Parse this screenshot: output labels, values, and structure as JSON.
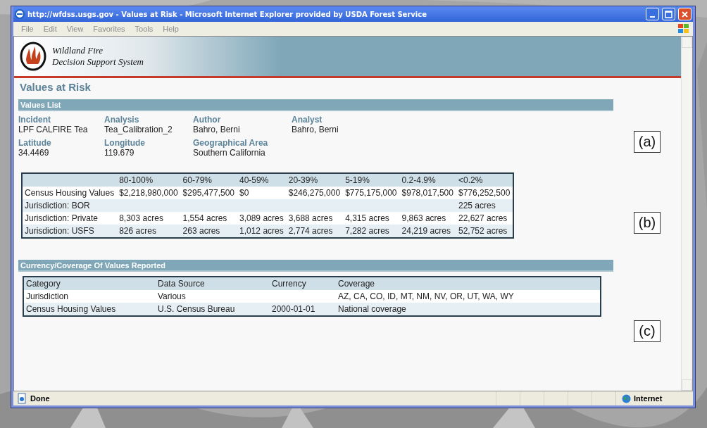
{
  "window": {
    "title": "http://wfdss.usgs.gov - Values at Risk - Microsoft Internet Explorer provided by USDA Forest Service"
  },
  "menu": [
    "File",
    "Edit",
    "View",
    "Favorites",
    "Tools",
    "Help"
  ],
  "header": {
    "logo_lines": [
      "Wildland Fire",
      "Decision Support System"
    ]
  },
  "page_title": "Values at Risk",
  "values_list": {
    "title": "Values List",
    "field_rows": [
      [
        {
          "label": "Incident",
          "value": "LPF CALFIRE Tea"
        },
        {
          "label": "Analysis",
          "value": "Tea_Calibration_2"
        },
        {
          "label": "Author",
          "value": "Bahro, Berni"
        },
        {
          "label": "Analyst",
          "value": "Bahro, Berni"
        }
      ],
      [
        {
          "label": "Latitude",
          "value": "34.4469"
        },
        {
          "label": "Longitude",
          "value": "119.679"
        },
        {
          "label": "Geographical Area",
          "value": "Southern California"
        }
      ]
    ]
  },
  "values_table": {
    "columns": [
      "80-100%",
      "60-79%",
      "40-59%",
      "20-39%",
      "5-19%",
      "0.2-4.9%",
      "<0.2%"
    ],
    "rows": [
      {
        "name": "Census Housing Values",
        "cells": [
          "$2,218,980,000",
          "$295,477,500",
          "$0",
          "$246,275,000",
          "$775,175,000",
          "$978,017,500",
          "$776,252,500"
        ]
      },
      {
        "name": "Jurisdiction: BOR",
        "cells": [
          "",
          "",
          "",
          "",
          "",
          "",
          "225 acres"
        ]
      },
      {
        "name": "Jurisdiction: Private",
        "cells": [
          "8,303 acres",
          "1,554 acres",
          "3,089 acres",
          "3,688 acres",
          "4,315 acres",
          "9,863 acres",
          "22,627 acres"
        ]
      },
      {
        "name": "Jurisdiction: USFS",
        "cells": [
          "826 acres",
          "263 acres",
          "1,012 acres",
          "2,774 acres",
          "7,282 acres",
          "24,219 acres",
          "52,752 acres"
        ]
      }
    ]
  },
  "coverage": {
    "title": "Currency/Coverage Of Values Reported",
    "columns": [
      "Category",
      "Data Source",
      "Currency",
      "Coverage"
    ],
    "rows": [
      [
        "Jurisdiction",
        "Various",
        "",
        "AZ, CA, CO, ID, MT, NM, NV, OR, UT, WA, WY"
      ],
      [
        "Census Housing Values",
        "U.S. Census Bureau",
        "2000-01-01",
        "National coverage"
      ]
    ]
  },
  "annotations": [
    "(a)",
    "(b)",
    "(c)"
  ],
  "status_bar": {
    "status": "Done",
    "zone": "Internet"
  }
}
